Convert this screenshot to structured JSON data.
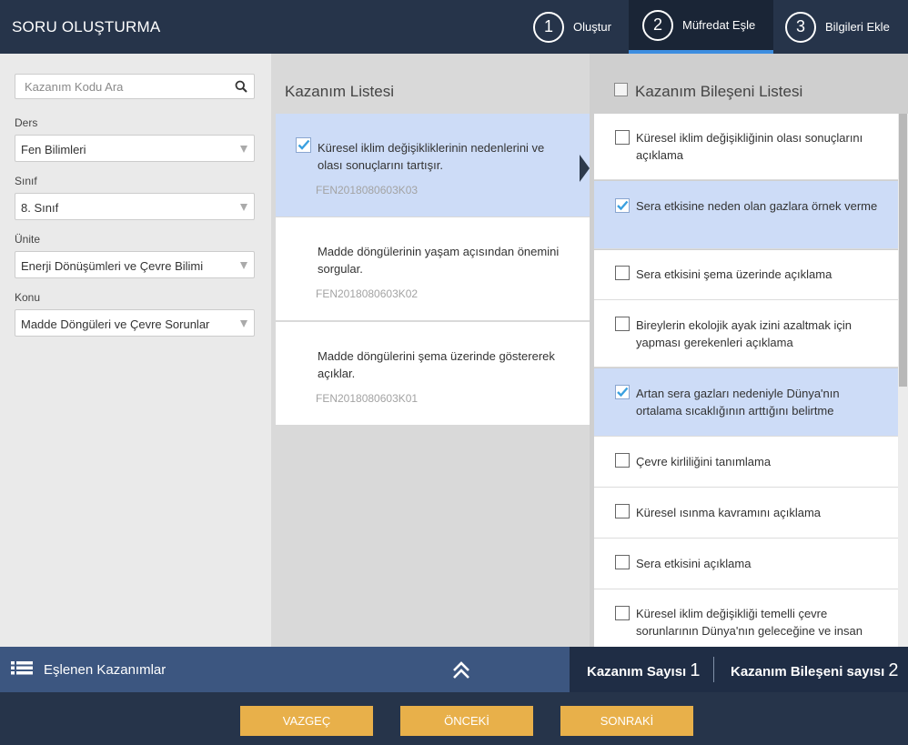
{
  "header": {
    "title": "SORU OLUŞTURMA",
    "steps": [
      {
        "number": "1",
        "label": "Oluştur"
      },
      {
        "number": "2",
        "label": "Müfredat Eşle",
        "active": true
      },
      {
        "number": "3",
        "label": "Bilgileri Ekle"
      }
    ]
  },
  "filters": {
    "search_placeholder": "Kazanım Kodu Ara",
    "ders_label": "Ders",
    "ders_value": "Fen Bilimleri",
    "sinif_label": "Sınıf",
    "sinif_value": "8. Sınıf",
    "unite_label": "Ünite",
    "unite_value": "Enerji Dönüşümleri ve Çevre Bilimi",
    "konu_label": "Konu",
    "konu_value": "Madde Döngüleri ve Çevre Sorunlar"
  },
  "kazanim_list": {
    "title": "Kazanım Listesi",
    "items": [
      {
        "text": "Küresel iklim değişikliklerinin nedenlerini ve olası sonuçlarını tartışır.",
        "code": "FEN2018080603K03",
        "selected": true
      },
      {
        "text": "Madde döngülerinin yaşam açısından önemini sorgular.",
        "code": "FEN2018080603K02",
        "selected": false
      },
      {
        "text": "Madde döngülerini şema üzerinde göstererek açıklar.",
        "code": "FEN2018080603K01",
        "selected": false
      }
    ]
  },
  "bilesen_list": {
    "title": "Kazanım Bileşeni Listesi",
    "items": [
      {
        "text": "Küresel iklim değişikliğinin olası sonuçlarını açıklama",
        "checked": false
      },
      {
        "text": "Sera etkisine neden olan gazlara örnek verme",
        "checked": true
      },
      {
        "text": "Sera etkisini şema üzerinde açıklama",
        "checked": false
      },
      {
        "text": "Bireylerin ekolojik ayak izini azaltmak için yapması gerekenleri açıklama",
        "checked": false
      },
      {
        "text": "Artan sera gazları nedeniyle Dünya'nın ortalama sıcaklığının arttığını belirtme",
        "checked": true
      },
      {
        "text": "Çevre kirliliğini tanımlama",
        "checked": false
      },
      {
        "text": "Küresel ısınma kavramını açıklama",
        "checked": false
      },
      {
        "text": "Sera etkisini açıklama",
        "checked": false
      },
      {
        "text": "Küresel iklim değişikliği temelli çevre sorunlarının Dünya'nın geleceğine ve insan",
        "checked": false
      }
    ]
  },
  "bottom_bar": {
    "label": "Eşlenen Kazanımlar",
    "kazanim_count_label": "Kazanım Sayısı",
    "kazanim_count": "1",
    "bilesen_count_label": "Kazanım Bileşeni sayısı",
    "bilesen_count": "2"
  },
  "footer": {
    "cancel_label": "VAZGEÇ",
    "prev_label": "ÖNCEKİ",
    "next_label": "SONRAKİ"
  },
  "colors": {
    "header_bg": "#26344a",
    "accent_blue": "#3d8ee0",
    "selected_bg": "#cddcf7",
    "check_color": "#3aa0e0",
    "button_bg": "#e8b04a",
    "bottom_bar_bg": "#3c5680"
  }
}
